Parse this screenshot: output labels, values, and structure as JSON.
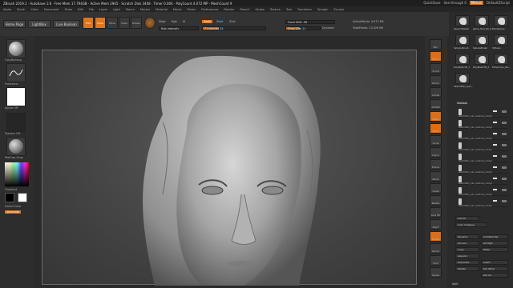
{
  "titlebar": {
    "text": "ZBrush 2019.1  · AutoSave 1:6  · Free Mem 17.794GB · Active Mem 2945 · Scratch Disk 3408 · Timer 0.004 · PolyCount 4.072 MP · MeshCount 9",
    "quicksave": "QuickSave",
    "see_through": "See-through 0",
    "menus": "Menus",
    "default_script": "DefaultZScript"
  },
  "menubar": [
    "Alpha",
    "Brush",
    "Color",
    "Document",
    "Draw",
    "Edit",
    "File",
    "Layer",
    "Light",
    "Macro",
    "Marker",
    "Material",
    "Movie",
    "Picker",
    "Preferences",
    "Render",
    "Stencil",
    "Stroke",
    "Texture",
    "Tool",
    "Transform",
    "Zplugin",
    "Zscript"
  ],
  "toolbar": {
    "home": "Home Page",
    "lightbox": "LightBox",
    "live_boolean": "Live Boolean",
    "edit": "Edit",
    "draw": "Draw",
    "move": "Move",
    "scale": "Scale",
    "rotate": "Rotate",
    "mrgb": "Mrgb",
    "rgb": "Rgb",
    "m": "M",
    "zadd": "Zadd",
    "zsub": "Zsub",
    "zcut": "Zcut",
    "rgb_intensity": "Rgb Intensity",
    "z_intensity": "Z Intensity 25",
    "focal_shift": "Focal Shift -96",
    "draw_size": "Draw Size 11",
    "dynamic": "Dynamic",
    "active_points": "ActivePoints: 4.072 Mil",
    "total_points": "TotalPoints: 13.029 Mil"
  },
  "left": {
    "brush": "ClayBuildup",
    "stroke": "FreeHand",
    "alpha": "Alpha Off",
    "texture": "Texture Off",
    "material": "MatCap Gray",
    "gradient": "Gradient",
    "switch": "SwitchColor",
    "alternate": "Alternate"
  },
  "rightshelf": [
    "Bpr",
    "SPix 3",
    "Scroll",
    "Zoom",
    "Actual",
    "AAHalf",
    "Persp",
    "Floor",
    "Local",
    "LSym",
    "Frame",
    "Move",
    "Scale",
    "Rotate",
    "Line Fill",
    "PolyF",
    "Transp",
    "Ghost",
    "Solo",
    "Xpose"
  ],
  "rightpanel": {
    "tools": [
      "Akeel-Haslam",
      "Jamie_Hair_No_0",
      "PolySphere",
      "Simple Brush",
      "SphereBrush",
      "3DScan",
      "PolyMesh3D_1",
      "PolyMesh3D_2",
      "Fisherman_Glo...",
      "Sketchfab_ryan..."
    ],
    "subtool_header": "Subtool",
    "subtools": [
      "Sketchfab_ryan_anatomy_bodys",
      "Sketchfab_ryan_anatomy_bodys",
      "Sketchfab_ryan_anatomy_bodys",
      "Sketchfab_ryan_anatomy_bodys",
      "Sketchfab_ryan_anatomy_bodys",
      "Sketchfab_ryan_anatomy_bodys",
      "Sketchfab_ryan_anatomy_bodys",
      "Sketchfab_ryan_anatomy_bodys",
      "Sketchfab_ryan_anatomy_bodys"
    ],
    "list_all": "List All",
    "auto_collapse": "Auto Collapse",
    "rename": "Rename",
    "autoreorder": "AutoReorder",
    "all_low": "All Low",
    "all_high": "All High",
    "copy": "Copy",
    "paste": "Paste",
    "append": "Append",
    "duplicate": "Duplicate",
    "insert": "Insert",
    "delete": "Delete",
    "del_other": "Del Other",
    "del_all": "Del All",
    "split": "Split"
  }
}
